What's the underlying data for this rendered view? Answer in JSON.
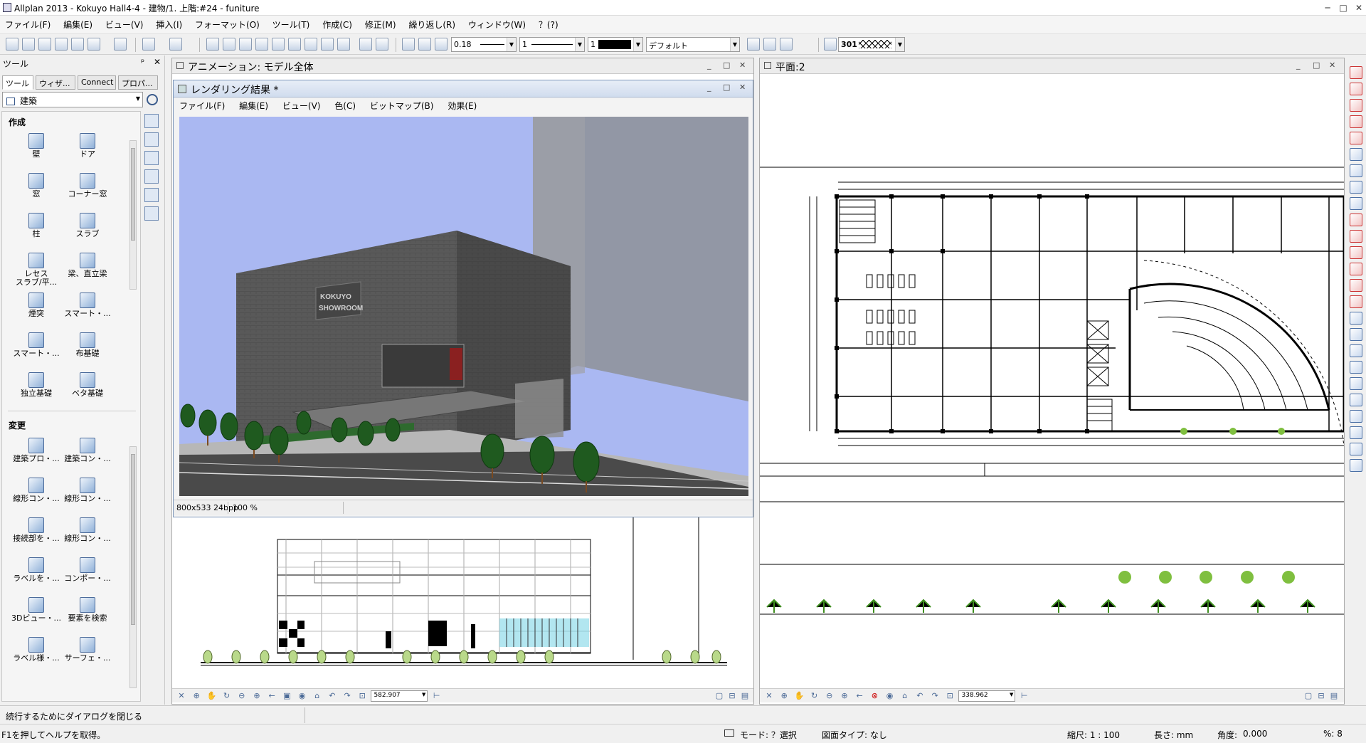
{
  "titlebar": {
    "title": "Allplan 2013 - Kokuyo Hall4-4 - 建物/1. 上階:#24 - funiture",
    "min": "─",
    "max": "□",
    "close": "✕"
  },
  "menubar": [
    "ファイル(F)",
    "編集(E)",
    "ビュー(V)",
    "挿入(I)",
    "フォーマット(O)",
    "ツール(T)",
    "作成(C)",
    "修正(M)",
    "繰り返し(R)",
    "ウィンドウ(W)",
    "？(?)"
  ],
  "toolbar": {
    "pen_thickness": "0.18",
    "line_type": "1",
    "color_index": "1",
    "layer": "デフォルト",
    "pattern": "301"
  },
  "palette": {
    "title": "ツール",
    "pin": "ᵖ",
    "close": "✕",
    "tabs": [
      "ツール",
      "ウィザ...",
      "Connect",
      "プロパ..."
    ],
    "module": "建築",
    "section_create": "作成",
    "section_modify": "変更",
    "create_tools": [
      [
        "壁",
        "ドア"
      ],
      [
        "窓",
        "コーナー窓"
      ],
      [
        "柱",
        "スラブ"
      ],
      [
        "レセス\nスラブ/平...",
        "梁、直立梁"
      ],
      [
        "煙突",
        "スマート・..."
      ],
      [
        "スマート・...",
        "布基礎"
      ],
      [
        "独立基礎",
        "ベタ基礎"
      ]
    ],
    "modify_tools": [
      [
        "建築プロ・...",
        "建築コン・..."
      ],
      [
        "線形コン・...",
        "線形コン・..."
      ],
      [
        "接続部を・...",
        "線形コン・..."
      ],
      [
        "ラベルを・...",
        "コンポー・..."
      ],
      [
        "3Dビュー・...",
        "要素を検索"
      ],
      [
        "ラベル様・...",
        "サーフェ・..."
      ]
    ]
  },
  "anim_pane": {
    "title": "アニメーション: モデル全体",
    "min": "_",
    "max": "□",
    "close": "✕"
  },
  "render_window": {
    "title": "レンダリング結果 *",
    "menu": [
      "ファイル(F)",
      "編集(E)",
      "ビュー(V)",
      "色(C)",
      "ビットマップ(B)",
      "効果(E)"
    ],
    "status_size": "800x533 24bpp",
    "status_zoom": "100 %",
    "sign_line1": "KOKUYO",
    "sign_line2": "SHOWROOM"
  },
  "plan_pane": {
    "title": "平面:2",
    "min": "_",
    "max": "□",
    "close": "✕"
  },
  "left_nav_value": "582.907",
  "right_nav_value": "338.962",
  "status": {
    "prompt": "続行するためにダイアログを閉じる",
    "help": "F1を押してヘルプを取得。",
    "mode": "モード: ？選択",
    "drawing_type": "図面タイプ: なし",
    "scale": "縮尺: 1 : 100",
    "length": "長さ: mm",
    "angle_label": "角度:",
    "angle_value": "0.000",
    "percent": "%:  8"
  },
  "colors": {
    "sky": "#aab8f2",
    "building": "#555555",
    "glass": "#8c8f98",
    "accent": "#3c6cb4"
  }
}
